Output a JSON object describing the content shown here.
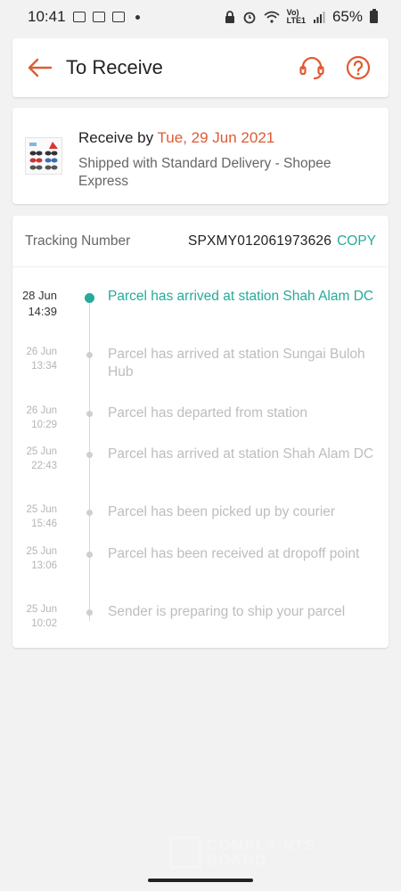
{
  "status_bar": {
    "time": "10:41",
    "network_label": "Vo)\nLTE1",
    "battery": "65%"
  },
  "header": {
    "title": "To Receive",
    "accent_color": "#e05a33"
  },
  "delivery": {
    "receive_prefix": "Receive by",
    "receive_date": "Tue, 29 Jun 2021",
    "shipping_info": "Shipped with Standard Delivery  - Shopee Express"
  },
  "tracking": {
    "label": "Tracking Number",
    "number": "SPXMY012061973626",
    "copy_label": "COPY",
    "active_color": "#26aa99",
    "events": [
      {
        "date": "28 Jun",
        "time": "14:39",
        "text": "Parcel has arrived at station Shah Alam DC"
      },
      {
        "date": "26 Jun",
        "time": "13:34",
        "text": "Parcel has arrived at station Sungai Buloh Hub"
      },
      {
        "date": "26 Jun",
        "time": "10:29",
        "text": "Parcel has departed from station"
      },
      {
        "date": "25 Jun",
        "time": "22:43",
        "text": "Parcel has arrived at station Shah Alam DC"
      },
      {
        "date": "25 Jun",
        "time": "15:46",
        "text": "Parcel has been picked up by courier"
      },
      {
        "date": "25 Jun",
        "time": "13:06",
        "text": "Parcel has been received at dropoff point"
      },
      {
        "date": "25 Jun",
        "time": "10:02",
        "text": "Sender is preparing to ship your parcel"
      }
    ]
  },
  "watermark": {
    "line1": "COMPLAINTS",
    "line2": "BOARD"
  }
}
